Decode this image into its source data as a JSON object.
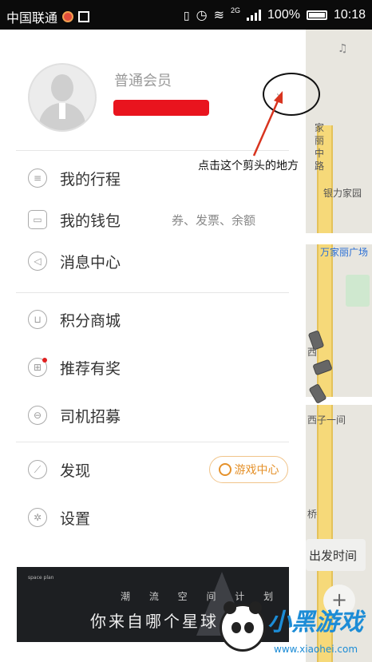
{
  "status_bar": {
    "carrier": "中国联通",
    "network": "2G",
    "battery": "100%",
    "time": "10:18"
  },
  "profile": {
    "member_level": "普通会员"
  },
  "menu": {
    "trips": "我的行程",
    "wallet": "我的钱包",
    "wallet_extra": "券、发票、余额",
    "messages": "消息中心",
    "points_mall": "积分商城",
    "referral": "推荐有奖",
    "driver_recruit": "司机招募",
    "discover": "发现",
    "game_center": "游戏中心",
    "settings": "设置"
  },
  "banner": {
    "subtitle": "潮 流 空 间 计 划",
    "title": "你来自哪个星球",
    "small_text": "space plan"
  },
  "annotation": {
    "text": "点击这个剪头的地方"
  },
  "map": {
    "road_label": "家丽中路",
    "poi_1": "银力家园",
    "poi_2": "万家丽广场",
    "poi_3": "西子一间",
    "poi_4": "西",
    "poi_5": "桥",
    "departure": "出发时间"
  },
  "watermark": {
    "title": "小黑游戏",
    "url": "www.xiaohei.com"
  },
  "colors": {
    "accent_orange": "#e5912a",
    "redaction": "#e9141e",
    "road": "#f6d979"
  }
}
